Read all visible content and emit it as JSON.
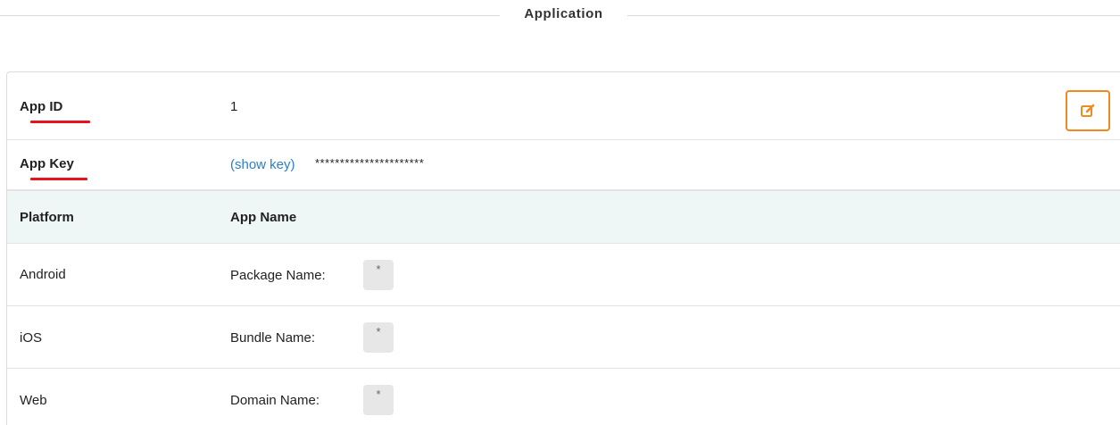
{
  "section": {
    "title": "Application"
  },
  "app_id": {
    "label": "App ID",
    "value": "1"
  },
  "app_key": {
    "label": "App Key",
    "show_key_link": "(show key)",
    "masked_value": "**********************"
  },
  "table": {
    "headers": {
      "platform": "Platform",
      "app_name": "App Name"
    },
    "rows": [
      {
        "platform": "Android",
        "field_label": "Package Name:",
        "value": "*"
      },
      {
        "platform": "iOS",
        "field_label": "Bundle Name:",
        "value": "*"
      },
      {
        "platform": "Web",
        "field_label": "Domain Name:",
        "value": "*"
      }
    ]
  },
  "colors": {
    "accent_orange": "#f08a1c",
    "underline_red": "#e8141d",
    "link_blue": "#2a7fc9",
    "header_bg": "#eef6f6"
  },
  "icons": {
    "edit": "edit-icon"
  }
}
